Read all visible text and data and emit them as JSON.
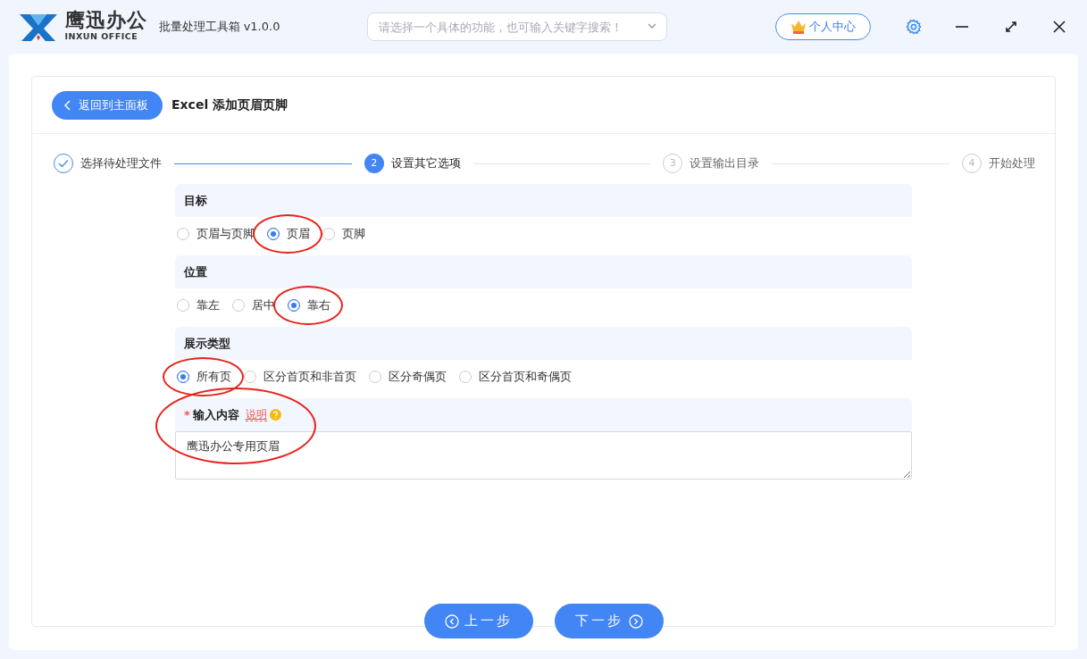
{
  "app": {
    "brand": "鹰迅办公",
    "brand_sub": "INXUN OFFICE",
    "title": "批量处理工具箱 v1.0.0",
    "search": {
      "placeholder": "请选择一个具体的功能，也可输入关键字搜索！"
    },
    "user_button": "个人中心"
  },
  "header": {
    "back_button": "返回到主面板",
    "title": "Excel 添加页眉页脚"
  },
  "steps": [
    {
      "label": "选择待处理文件",
      "done": true,
      "active": false
    },
    {
      "number": "2",
      "label": "设置其它选项",
      "done": false,
      "active": true
    },
    {
      "number": "3",
      "label": "设置输出目录",
      "done": false,
      "active": false
    },
    {
      "number": "4",
      "label": "开始处理",
      "done": false,
      "active": false
    }
  ],
  "sections": [
    {
      "kind": "radio",
      "title": "目标",
      "options": [
        {
          "label": "页眉与页脚",
          "selected": false,
          "circled": false
        },
        {
          "label": "页眉",
          "selected": true,
          "circled": true
        },
        {
          "label": "页脚",
          "selected": false,
          "circled": false
        }
      ]
    },
    {
      "kind": "radio",
      "title": "位置",
      "options": [
        {
          "label": "靠左",
          "selected": false,
          "circled": false
        },
        {
          "label": "居中",
          "selected": false,
          "circled": false
        },
        {
          "label": "靠右",
          "selected": true,
          "circled": true
        }
      ]
    },
    {
      "kind": "radio",
      "title": "展示类型",
      "options": [
        {
          "label": "所有页",
          "selected": true,
          "circled": true
        },
        {
          "label": "区分首页和非首页",
          "selected": false,
          "circled": false
        },
        {
          "label": "区分奇偶页",
          "selected": false,
          "circled": false
        },
        {
          "label": "区分首页和奇偶页",
          "selected": false,
          "circled": false
        }
      ]
    },
    {
      "kind": "text",
      "title": "输入内容",
      "required_mark": "*",
      "help_link": "说明",
      "circled": true,
      "value": "鹰迅办公专用页眉"
    }
  ],
  "footer": {
    "prev_button": "上一步",
    "next_button": "下一步"
  }
}
